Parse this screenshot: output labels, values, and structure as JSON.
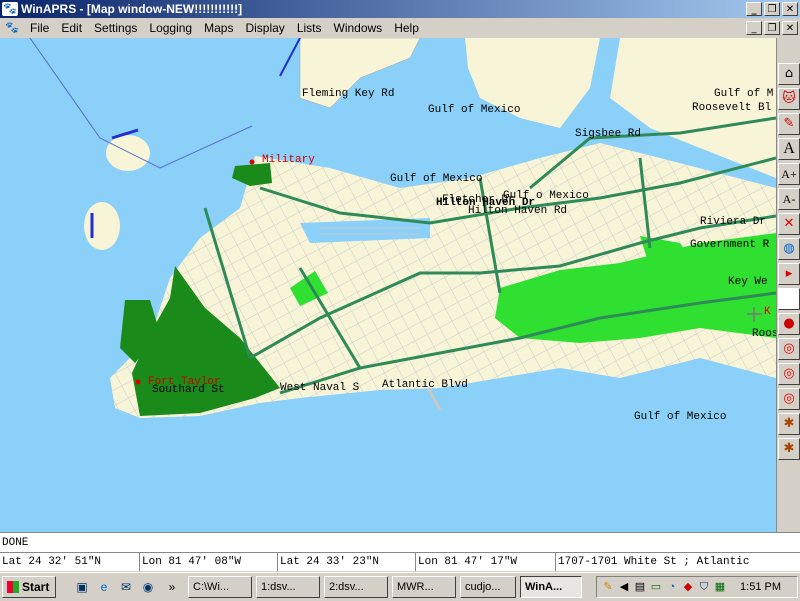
{
  "window": {
    "title": "WinAPRS - [Map window-NEW!!!!!!!!!!!]",
    "app_icon": "winaprs-cat-icon",
    "controls": [
      "_",
      "❐",
      "✕"
    ]
  },
  "menu": {
    "items": [
      "File",
      "Edit",
      "Settings",
      "Logging",
      "Maps",
      "Display",
      "Lists",
      "Windows",
      "Help"
    ],
    "controls": [
      "_",
      "❐",
      "✕"
    ]
  },
  "map": {
    "colors": {
      "water": "#8ad0f8",
      "land": "#f8f4d8",
      "park": "#1a8a1a",
      "park_light": "#30e030",
      "highway": "#2e8b57",
      "street": "#c8c8c8"
    },
    "labels": {
      "fleming_key": "Fleming Key Rd",
      "gulf1": "Gulf of Mexico",
      "gulf2": "Gulf of Mexico",
      "gulf3": "Gulf of M",
      "gulf4": "Gulf o  Mexico",
      "gulf5": "Gulf of Mexico",
      "sigsbee": "Sigsbee Rd",
      "roosevelt": "Roosevelt Bl",
      "military": "Military",
      "hilton_dr": "Hilton Haven Dr",
      "hilton_rd": "Hilton Haven Rd",
      "fletcher": "Fletcher Dr",
      "riviera": "Riviera Dr",
      "government": "Government R",
      "key_west": "Key We",
      "key_partial": "K",
      "roos_partial": "Roos",
      "fort_taylor": "Fort Taylor",
      "southard": "Southard St",
      "west_naval": "West Naval S",
      "atlantic": "Atlantic Blvd"
    }
  },
  "toolbar": {
    "tools": [
      {
        "name": "home-icon",
        "glyph": "⌂"
      },
      {
        "name": "cat-icon",
        "glyph": "🐱"
      },
      {
        "name": "cat-edit-icon",
        "glyph": "✎"
      },
      {
        "name": "font-icon",
        "glyph": "A"
      },
      {
        "name": "font-larger-icon",
        "glyph": "A+"
      },
      {
        "name": "font-smaller-icon",
        "glyph": "A-"
      },
      {
        "name": "delete-icon",
        "glyph": "✕"
      },
      {
        "name": "globe-icon",
        "glyph": "◍"
      },
      {
        "name": "flag-icon",
        "glyph": "▸"
      },
      {
        "name": "blank-icon",
        "glyph": ""
      },
      {
        "name": "pin-icon",
        "glyph": "●"
      },
      {
        "name": "target-icon-1",
        "glyph": "◎"
      },
      {
        "name": "target-icon-2",
        "glyph": "◎"
      },
      {
        "name": "target-icon-3",
        "glyph": "◎"
      },
      {
        "name": "bug-icon-1",
        "glyph": "✱"
      },
      {
        "name": "bug-icon-2",
        "glyph": "✱"
      }
    ]
  },
  "status": {
    "text": "DONE"
  },
  "coords": {
    "lat1": "Lat  24 32' 51\"N",
    "lon1": "Lon  81 47' 08\"W",
    "lat2": "Lat  24 33' 23\"N",
    "lon2": "Lon  81 47' 17\"W",
    "address": "1707-1701  White St ; Atlantic"
  },
  "taskbar": {
    "start": "Start",
    "tasks": [
      "C:\\Wi...",
      "1:dsv...",
      "2:dsv...",
      "MWR...",
      "cudjo...",
      "WinA..."
    ],
    "active_task": 5,
    "clock": "1:51 PM",
    "quicklaunch": [
      "desktop-icon",
      "ie-icon",
      "outlook-icon",
      "channel-icon"
    ],
    "tray": [
      "pencil-icon",
      "speaker-icon",
      "network-icon",
      "monitor-icon",
      "eye-icon",
      "antivirus-icon",
      "shield-icon",
      "scheduler-icon"
    ]
  }
}
